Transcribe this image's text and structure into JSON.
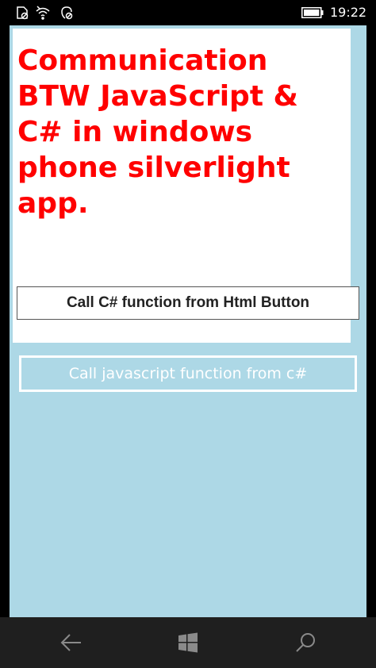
{
  "status_bar": {
    "time": "19:22",
    "icons": [
      "sim-off-icon",
      "wifi-icon",
      "location-off-icon"
    ],
    "battery_level": 0.9
  },
  "webview": {
    "title": "Communication BTW JavaScript & C# in windows phone silverlight app.",
    "html_button_label": "Call C# function from Html Button"
  },
  "native": {
    "button_label": "Call javascript function from c#"
  },
  "nav_bar": {
    "icons": [
      "back-icon",
      "windows-start-icon",
      "search-icon"
    ]
  },
  "colors": {
    "app_background": "#add8e6",
    "title_color": "#ff0000",
    "nav_bar": "#1f1f1f"
  }
}
